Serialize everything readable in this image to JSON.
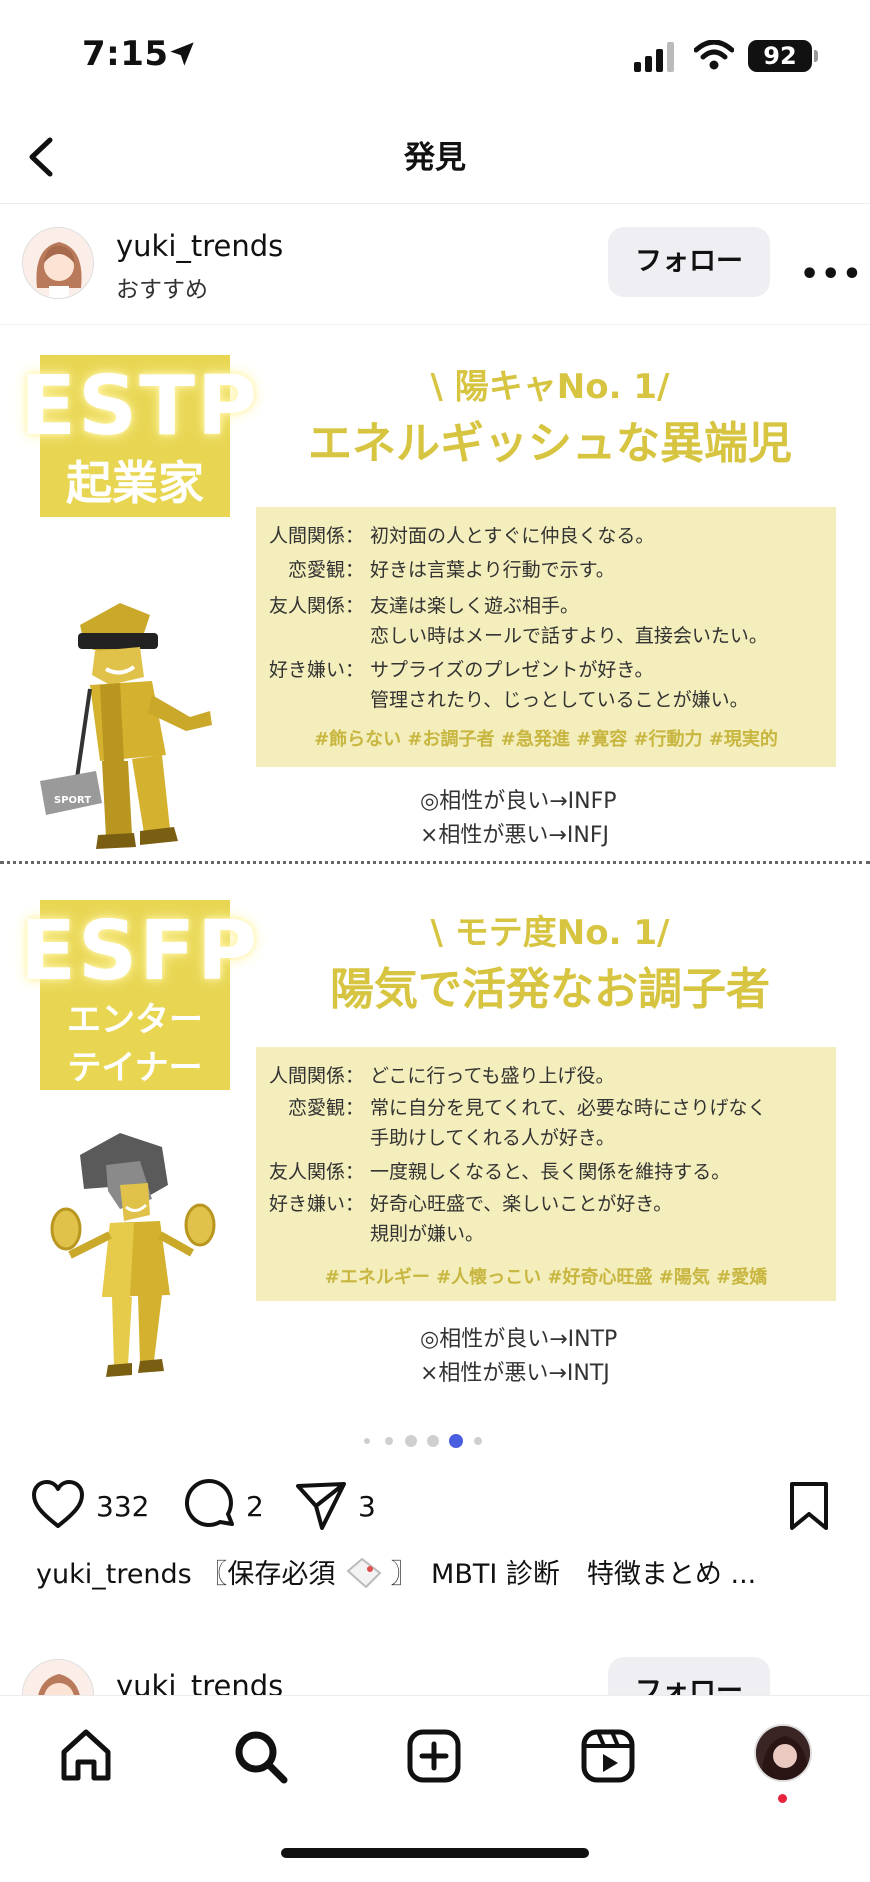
{
  "status_bar": {
    "time": "7:15",
    "battery": "92"
  },
  "header": {
    "title": "発見"
  },
  "post": {
    "username": "yuki_trends",
    "subtitle": "おすすめ",
    "follow_label": "フォロー",
    "cards": [
      {
        "code": "ESTP",
        "type_name": "起業家",
        "rank": "\\ 陽キャNo. 1/",
        "headline": "エネルギッシュな異端児",
        "rows": [
          {
            "key": "人間関係：",
            "lines": [
              "初対面の人とすぐに仲良くなる。"
            ]
          },
          {
            "key": "恋愛観：",
            "lines": [
              "好きは言葉より行動で示す。"
            ]
          },
          {
            "key": "友人関係：",
            "lines": [
              "友達は楽しく遊ぶ相手。",
              "恋しい時はメールで話すより、直接会いたい。"
            ]
          },
          {
            "key": "好き嫌い：",
            "lines": [
              "サプライズのプレゼントが好き。",
              "管理されたり、じっとしていることが嫌い。"
            ]
          }
        ],
        "tags": "#飾らない #お調子者 #急発進 #寛容 #行動力 #現実的",
        "good": "◎相性が良い→INFP",
        "bad": "×相性が悪い→INFJ",
        "bag_label": "SPORT"
      },
      {
        "code": "ESFP",
        "type_name_1": "エンター",
        "type_name_2": "テイナー",
        "rank": "\\ モテ度No. 1/",
        "headline": "陽気で活発なお調子者",
        "rows": [
          {
            "key": "人間関係：",
            "lines": [
              "どこに行っても盛り上げ役。"
            ]
          },
          {
            "key": "恋愛観：",
            "lines": [
              "常に自分を見てくれて、必要な時にさりげなく",
              "手助けしてくれる人が好き。"
            ]
          },
          {
            "key": "友人関係：",
            "lines": [
              "一度親しくなると、長く関係を維持する。"
            ]
          },
          {
            "key": "好き嫌い：",
            "lines": [
              "好奇心旺盛で、楽しいことが好き。",
              "規則が嫌い。"
            ]
          }
        ],
        "tags": "#エネルギー #人懐っこい #好奇心旺盛 #陽気 #愛嬌",
        "good": "◎相性が良い→INTP",
        "bad": "×相性が悪い→INTJ"
      }
    ],
    "carousel": {
      "count": 6,
      "active_index": 4
    },
    "likes": "332",
    "comments": "2",
    "shares": "3",
    "caption_user": "yuki_trends",
    "caption_before": "〖保存必須",
    "caption_after": "〗　MBTI 診断　特徴まとめ ..."
  },
  "next_post": {
    "username": "yuki_trends",
    "follow_label": "フォロー"
  },
  "colors": {
    "accent_yellow": "#e8d653",
    "panel_yellow": "#f3eebb",
    "active_dot": "#4a5fe0"
  }
}
